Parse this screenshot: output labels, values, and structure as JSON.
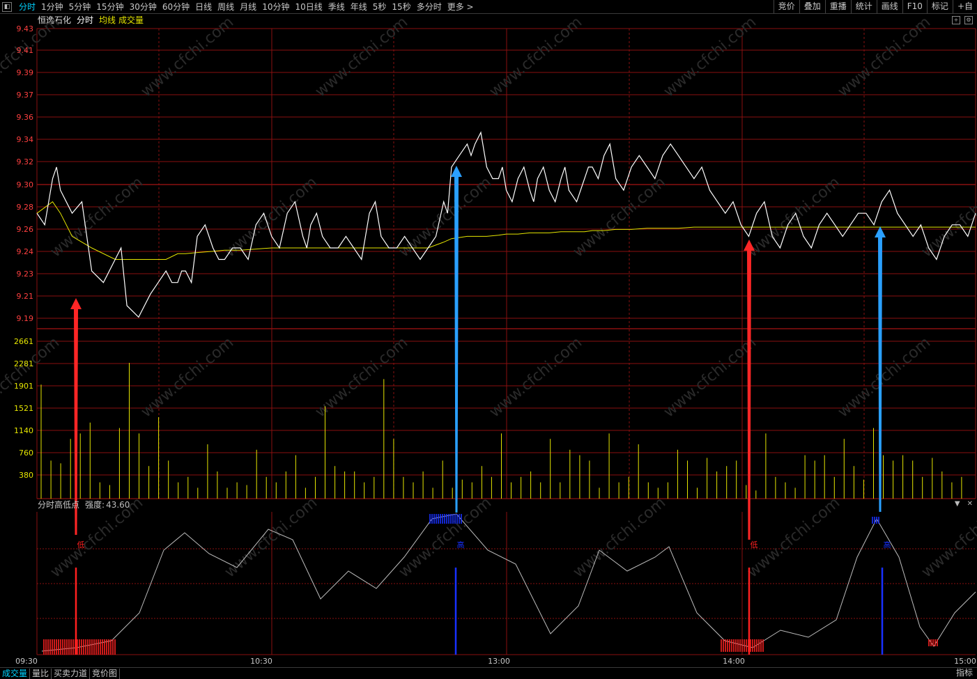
{
  "toolbar": {
    "periods": [
      "分时",
      "1分钟",
      "5分钟",
      "15分钟",
      "30分钟",
      "60分钟",
      "日线",
      "周线",
      "月线",
      "10分钟",
      "10日线",
      "季线",
      "年线",
      "5秒",
      "15秒",
      "多分时",
      "更多 >"
    ],
    "tools": [
      "竞价",
      "叠加",
      "重播",
      "统计",
      "画线",
      "F10",
      "标记",
      "+自"
    ]
  },
  "info": {
    "stock": "恒逸石化",
    "mode": "分时",
    "avg_label": "均线",
    "vol_label": "成交量"
  },
  "price_axis": [
    "9.43",
    "9.41",
    "9.39",
    "9.37",
    "9.36",
    "9.34",
    "9.32",
    "9.30",
    "9.28",
    "9.26",
    "9.24",
    "9.23",
    "9.21",
    "9.19"
  ],
  "volume_axis": [
    "2661",
    "2281",
    "1901",
    "1521",
    "1140",
    "760",
    "380"
  ],
  "time_axis": [
    "09:30",
    "10:30",
    "13:00",
    "14:00",
    "15:00"
  ],
  "indicator": {
    "name": "分时高低点",
    "strength_label": "强度:",
    "strength_value": "43.60"
  },
  "markers": [
    {
      "label": "低",
      "color": "#ff2020"
    },
    {
      "label": "高",
      "color": "#1830ff"
    },
    {
      "label": "低",
      "color": "#ff2020"
    },
    {
      "label": "高",
      "color": "#1830ff"
    }
  ],
  "bottom_tabs": [
    "成交量",
    "量比",
    "买卖力道",
    "竞价图"
  ],
  "bottom_right": "指标",
  "watermark": "www.cfchi.com",
  "colors": {
    "grid": "#8a1010",
    "price_line": "#ffffff",
    "avg_line": "#e6e600",
    "axis_text_up": "#ff4040",
    "volume_text": "#e6e600",
    "active": "#00d2ff"
  },
  "chart_data": {
    "type": "line",
    "x_minutes": [
      0,
      4,
      6,
      9,
      14,
      20,
      23,
      29,
      33,
      36,
      38,
      41,
      45,
      48,
      52,
      56,
      60,
      64,
      68,
      70,
      73,
      77,
      81,
      85,
      88,
      92,
      96,
      100,
      104,
      106,
      110,
      112,
      115,
      118,
      120,
      123,
      126,
      128,
      131,
      134,
      136,
      140,
      142,
      145,
      148,
      152,
      156,
      160,
      164,
      168,
      172,
      176,
      180,
      184,
      188,
      192,
      196,
      200,
      204,
      208,
      212,
      216,
      220,
      224,
      228,
      232,
      236,
      240
    ],
    "price": [
      9.27,
      9.3,
      9.29,
      9.27,
      9.22,
      9.23,
      9.19,
      9.2,
      9.22,
      9.21,
      9.22,
      9.25,
      9.24,
      9.23,
      9.24,
      9.26,
      9.25,
      9.27,
      9.25,
      9.26,
      9.25,
      9.24,
      9.24,
      9.27,
      9.25,
      9.24,
      9.24,
      9.24,
      9.28,
      9.31,
      9.33,
      9.33,
      9.31,
      9.3,
      9.29,
      9.3,
      9.29,
      9.3,
      9.29,
      9.3,
      9.29,
      9.3,
      9.31,
      9.32,
      9.3,
      9.31,
      9.31,
      9.32,
      9.32,
      9.3,
      9.29,
      9.27,
      9.26,
      9.27,
      9.25,
      9.26,
      9.25,
      9.26,
      9.26,
      9.26,
      9.27,
      9.28,
      9.27,
      9.25,
      9.24,
      9.25,
      9.26,
      9.27
    ],
    "avg": [
      9.27,
      9.28,
      9.27,
      9.25,
      9.24,
      9.23,
      9.23,
      9.23,
      9.23,
      9.235,
      9.235,
      9.236,
      9.237,
      9.238,
      9.238,
      9.239,
      9.24,
      9.24,
      9.24,
      9.24,
      9.24,
      9.24,
      9.24,
      9.24,
      9.24,
      9.24,
      9.24,
      9.24,
      9.245,
      9.248,
      9.25,
      9.25,
      9.25,
      9.251,
      9.252,
      9.252,
      9.253,
      9.253,
      9.253,
      9.254,
      9.254,
      9.254,
      9.255,
      9.255,
      9.256,
      9.256,
      9.257,
      9.257,
      9.257,
      9.258,
      9.258,
      9.258,
      9.258,
      9.258,
      9.258,
      9.258,
      9.258,
      9.258,
      9.258,
      9.258,
      9.258,
      9.258,
      9.258,
      9.258,
      9.258,
      9.258,
      9.258,
      9.258
    ],
    "yrange": [
      9.17,
      9.43
    ],
    "volume_range": [
      0,
      3000
    ],
    "volume": [
      2100,
      700,
      650,
      1100,
      1200,
      1400,
      300,
      250,
      1300,
      2500,
      1200,
      600,
      1500,
      700,
      300,
      400,
      200,
      1000,
      500,
      200,
      300,
      250,
      900,
      400,
      300,
      500,
      800,
      200,
      400,
      1700,
      600,
      500,
      500,
      300,
      400,
      2200,
      1100,
      400,
      300,
      500,
      200,
      700,
      200,
      350,
      300,
      600,
      400,
      1200,
      300,
      400,
      500,
      300,
      1100,
      300,
      900,
      800,
      700,
      200,
      1200,
      300,
      400,
      1000,
      300,
      200,
      300,
      900,
      700,
      200,
      750,
      500,
      600,
      700,
      250,
      150,
      1200,
      400,
      300,
      200,
      800,
      700,
      800,
      400,
      1100,
      600,
      350,
      1300,
      800,
      700,
      800,
      700,
      400,
      750,
      500,
      300,
      400
    ]
  }
}
